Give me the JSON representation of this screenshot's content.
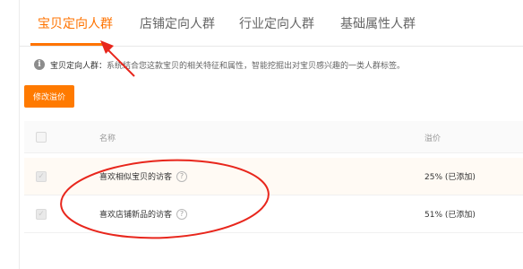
{
  "tabs": [
    {
      "label": "宝贝定向人群",
      "active": true
    },
    {
      "label": "店铺定向人群",
      "active": false
    },
    {
      "label": "行业定向人群",
      "active": false
    },
    {
      "label": "基础属性人群",
      "active": false
    }
  ],
  "info": {
    "icon": "i",
    "label": "宝贝定向人群：",
    "text": "系统结合您这款宝贝的相关特征和属性，智能挖掘出对宝贝感兴趣的一类人群标签。"
  },
  "modify_button": "修改溢价",
  "table": {
    "headers": {
      "name": "名称",
      "bid": "溢价"
    },
    "rows": [
      {
        "name": "喜欢相似宝贝的访客",
        "bid": "25% (已添加)"
      },
      {
        "name": "喜欢店铺新品的访客",
        "bid": "51% (已添加)"
      }
    ],
    "help_icon": "?",
    "check_glyph": "✓"
  },
  "colors": {
    "accent": "#ff7300",
    "annotation": "#e8261c"
  }
}
